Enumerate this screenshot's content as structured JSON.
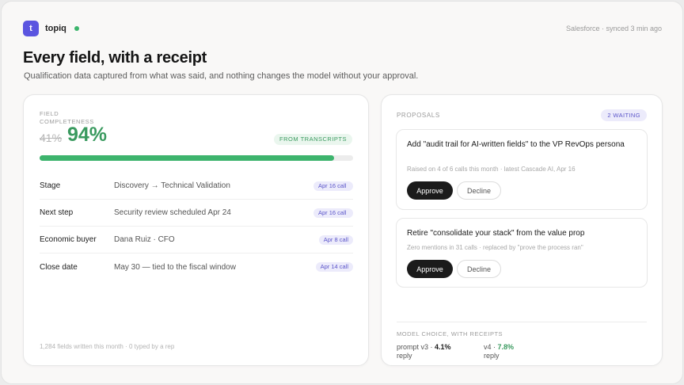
{
  "brand": {
    "logo_letter": "t",
    "name": "topiq",
    "status_color": "#3cb56c"
  },
  "sync_status": "Salesforce · synced 3 min ago",
  "header": {
    "title": "Every field, with a receipt",
    "subtitle": "Qualification data captured from what was said, and nothing changes the model without your approval."
  },
  "field_completeness": {
    "label": "FIELD COMPLETENESS",
    "previous": "41%",
    "current": "94%",
    "progress_fraction": 0.94,
    "source_chip": "FROM TRANSCRIPTS"
  },
  "fields": [
    {
      "label": "Stage",
      "value": "Discovery → Technical Validation",
      "source": "Apr 16 call"
    },
    {
      "label": "Next step",
      "value": "Security review scheduled Apr 24",
      "source": "Apr 16 call"
    },
    {
      "label": "Economic buyer",
      "value": "Dana Ruiz · CFO",
      "source": "Apr 8 call"
    },
    {
      "label": "Close date",
      "value": "May 30 — tied to the fiscal window",
      "source": "Apr 14 call"
    }
  ],
  "footnote": "1,284 fields written this month · 0 typed by a rep",
  "proposals": {
    "label": "PROPOSALS",
    "waiting_chip": "2 WAITING",
    "items": [
      {
        "title": "Add \"audit trail for AI-written fields\" to the VP RevOps persona",
        "meta": "Raised on 4 of 6 calls this month · latest Cascade AI, Apr 16",
        "approve_label": "Approve",
        "decline_label": "Decline"
      },
      {
        "title": "Retire \"consolidate your stack\" from the value prop",
        "meta": "Zero mentions in 31 calls · replaced by \"prove the process ran\"",
        "approve_label": "Approve",
        "decline_label": "Decline"
      }
    ]
  },
  "model_choice": {
    "label": "MODEL CHOICE, WITH RECEIPTS",
    "a": {
      "name": "prompt v3 ·",
      "value": "4.1%",
      "unit": "reply"
    },
    "b": {
      "name": "v4 ·",
      "value": "7.8%",
      "unit": "reply"
    }
  }
}
